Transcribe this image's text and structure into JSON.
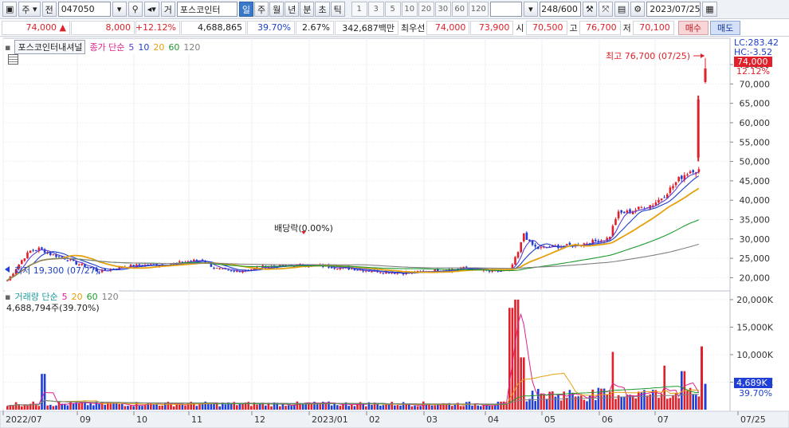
{
  "toolbar": {
    "market_label": "주",
    "code_prefix": "전",
    "code_value": "047050",
    "name_prefix": "거",
    "stock_name": "포스코인터",
    "periods": [
      "일",
      "주",
      "월",
      "년",
      "분",
      "초",
      "틱"
    ],
    "active_period": "일",
    "intervals": [
      "1",
      "3",
      "5",
      "10",
      "20",
      "30",
      "60",
      "120"
    ],
    "count": "248/600",
    "date": "2023/07/25"
  },
  "infobar": {
    "price": "74,000",
    "change_arrow": "▲",
    "change": "8,000",
    "change_pct": "+12.12%",
    "volume": "4,688,865",
    "volume_ratio": "39.70%",
    "turnover": "2.67%",
    "amount": "342,687백만",
    "best_label": "최우선",
    "ask": "74,000",
    "bid": "73,900",
    "open_label": "시",
    "open": "70,500",
    "high_label": "고",
    "high": "76,700",
    "low_label": "저",
    "low": "70,100",
    "buy_label": "매수",
    "sell_label": "매도"
  },
  "price_legend": {
    "name": "포스코인터내셔널",
    "ma_label": "종가 단순",
    "periods": [
      "5",
      "10",
      "20",
      "60",
      "120"
    ]
  },
  "volume_legend": {
    "label": "거래량 단순",
    "periods": [
      "5",
      "20",
      "60",
      "120"
    ],
    "value_text": "4,688,794주(39.70%)"
  },
  "right_scale": {
    "lc": "LC:283.42",
    "hc": "HC:-3.52",
    "price_tag": "74,000",
    "pct_tag": "12.12%",
    "vol_tag": "4,689K",
    "vol_pct_tag": "39.70%"
  },
  "annotations": {
    "high": "최고 76,700 (07/25)",
    "low": "최저 19,300 (07/27)",
    "dividend": "배당락(0.00%)"
  },
  "x_axis_labels": [
    "2022/07",
    "09",
    "10",
    "11",
    "12",
    "2023/01",
    "02",
    "03",
    "04",
    "05",
    "06",
    "07",
    "07/25"
  ],
  "y_axis_price": [
    "75,000",
    "70,000",
    "65,000",
    "60,000",
    "55,000",
    "50,000",
    "45,000",
    "40,000",
    "35,000",
    "30,000",
    "25,000",
    "20,000"
  ],
  "y_axis_volume": [
    "20,000K",
    "15,000K",
    "10,000K",
    "5,000K"
  ],
  "colors": {
    "up": "#e0202a",
    "down": "#1f3fd6",
    "ma5": "#5a3fd0",
    "ma10": "#1b3fc9",
    "ma20": "#e5a10d",
    "ma60": "#1f9a2f",
    "ma120": "#808080",
    "vol_ma5": "#e0208a"
  },
  "chart_data": {
    "type": "candlestick",
    "title": "포스코인터내셔널",
    "xlabel": "",
    "ylabel": "",
    "ylim": [
      17000,
      80000
    ],
    "volume_ylim": [
      0,
      21000000
    ],
    "series_price_keypoints": [
      {
        "x": "2022/07",
        "close": 19300
      },
      {
        "x": "2022/08",
        "close": 27500
      },
      {
        "x": "2022/09",
        "close": 25500
      },
      {
        "x": "2022/10",
        "close": 22500
      },
      {
        "x": "2022/11",
        "close": 22500
      },
      {
        "x": "2022/12",
        "close": 23500
      },
      {
        "x": "2023/01",
        "close": 22000
      },
      {
        "x": "2023/02",
        "close": 23500
      },
      {
        "x": "2023/03",
        "close": 21000
      },
      {
        "x": "2023/04",
        "close": 33000
      },
      {
        "x": "2023/05",
        "close": 29000
      },
      {
        "x": "2023/06",
        "close": 39000
      },
      {
        "x": "2023/07",
        "close": 50000
      },
      {
        "x": "07/25",
        "open": 70500,
        "high": 76700,
        "low": 70100,
        "close": 74000
      }
    ],
    "moving_averages": [
      "5",
      "10",
      "20",
      "60",
      "120"
    ],
    "volume_peaks": [
      {
        "x": "2023/04",
        "value": 20000000
      },
      {
        "x": "07/25",
        "value": 4688794
      }
    ],
    "grid": true,
    "legend_position": "top-left"
  }
}
